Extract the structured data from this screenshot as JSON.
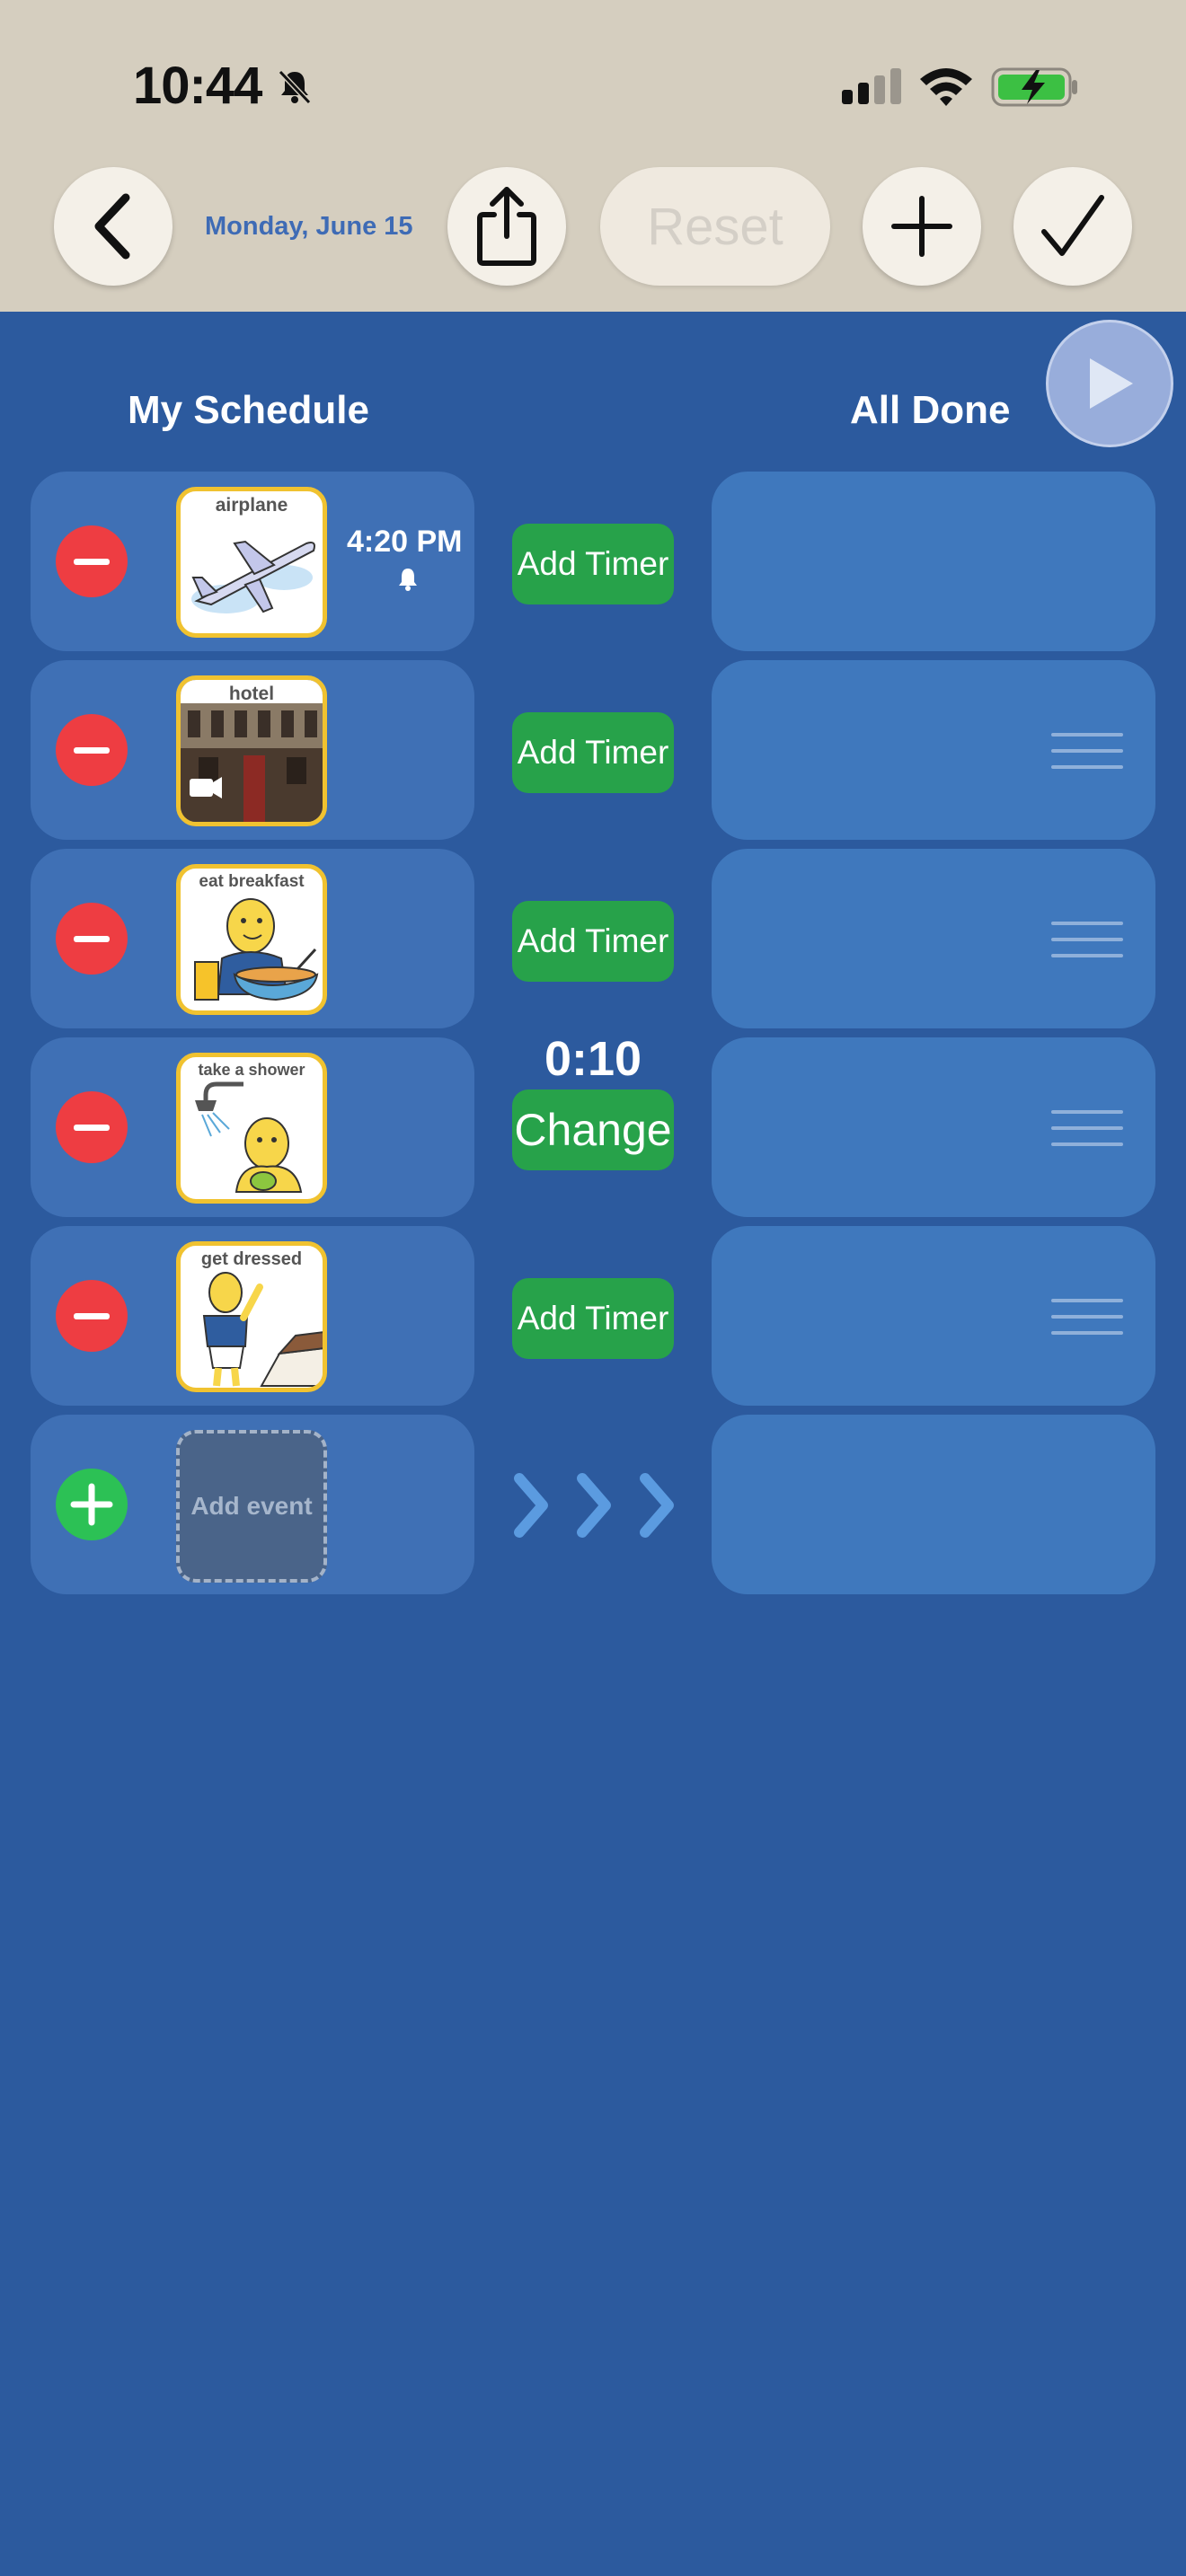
{
  "status_bar": {
    "time": "10:44"
  },
  "toolbar": {
    "date": "Monday, June 15",
    "reset_label": "Reset"
  },
  "columns": {
    "schedule_title": "My Schedule",
    "done_title": "All Done"
  },
  "events": [
    {
      "label": "airplane",
      "alarm_time": "4:20 PM",
      "timer_label": "Add Timer"
    },
    {
      "label": "hotel",
      "timer_label": "Add Timer"
    },
    {
      "label": "eat breakfast",
      "timer_label": "Add Timer"
    },
    {
      "label": "take a shower",
      "timer_value": "0:10",
      "timer_label": "Change"
    },
    {
      "label": "get dressed",
      "timer_label": "Add Timer"
    }
  ],
  "add_event": {
    "label": "Add event"
  },
  "colors": {
    "background": "#2c5a9e",
    "toolbar": "#d5cebf",
    "delete": "#ee3d42",
    "add": "#2cc155",
    "timer": "#27a24a",
    "card_border": "#f0c230"
  }
}
